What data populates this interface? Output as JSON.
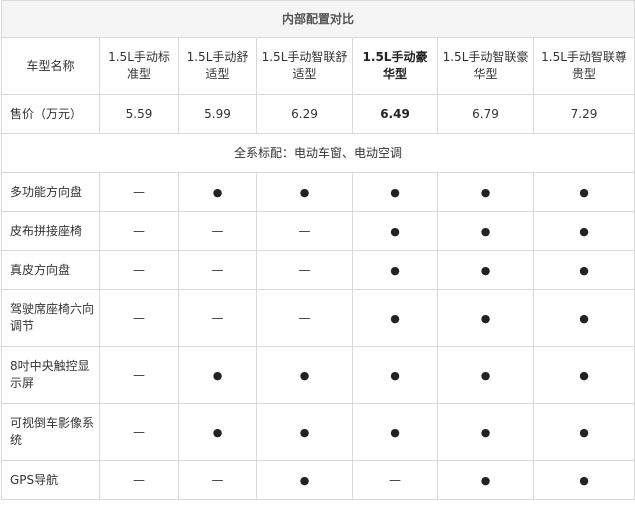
{
  "table": {
    "title": "内部配置对比",
    "header_label": "车型名称",
    "models": [
      {
        "name": "1.5L手动标准型",
        "highlight": false
      },
      {
        "name": "1.5L手动舒适型",
        "highlight": false
      },
      {
        "name": "1.5L手动智联舒适型",
        "highlight": false
      },
      {
        "name": "1.5L手动豪华型",
        "highlight": true
      },
      {
        "name": "1.5L手动智联豪华型",
        "highlight": false
      },
      {
        "name": "1.5L手动智联尊贵型",
        "highlight": false
      }
    ],
    "price_label": "售价（万元）",
    "prices": [
      "5.59",
      "5.99",
      "6.29",
      "6.49",
      "6.79",
      "7.29"
    ],
    "note": "全系标配：电动车窗、电动空调",
    "symbols": {
      "yes": "●",
      "no": "—"
    },
    "features": [
      {
        "label": "多功能方向盘",
        "values": [
          "—",
          "●",
          "●",
          "●",
          "●",
          "●"
        ],
        "tall": false
      },
      {
        "label": "皮布拼接座椅",
        "values": [
          "—",
          "—",
          "—",
          "●",
          "●",
          "●"
        ],
        "tall": false
      },
      {
        "label": "真皮方向盘",
        "values": [
          "—",
          "—",
          "—",
          "●",
          "●",
          "●"
        ],
        "tall": false
      },
      {
        "label": "驾驶席座椅六向调节",
        "values": [
          "—",
          "—",
          "—",
          "●",
          "●",
          "●"
        ],
        "tall": true
      },
      {
        "label": "8吋中央触控显示屏",
        "values": [
          "—",
          "●",
          "●",
          "●",
          "●",
          "●"
        ],
        "tall": true
      },
      {
        "label": "可视倒车影像系统",
        "values": [
          "—",
          "●",
          "●",
          "●",
          "●",
          "●"
        ],
        "tall": true
      },
      {
        "label": "GPS导航",
        "values": [
          "—",
          "—",
          "●",
          "—",
          "●",
          "●"
        ],
        "tall": false
      }
    ]
  }
}
